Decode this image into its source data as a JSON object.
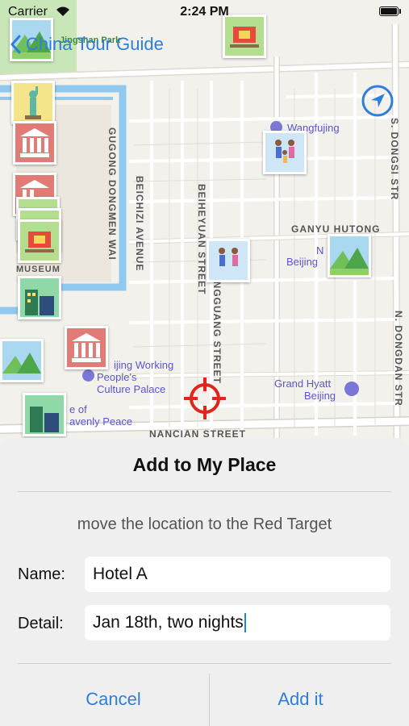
{
  "status_bar": {
    "carrier": "Carrier",
    "time": "2:24 PM"
  },
  "nav": {
    "back_label": "China Tour Guide"
  },
  "map": {
    "street_labels": {
      "gugong_dongmen": "GUGONG DONGMEN WAI",
      "beichizi": "BEICHIZI AVENUE",
      "beiheyuan": "BEIHEYUAN STREET",
      "hengguang": "HENGGUANG STREET",
      "ganyu": "GANYU HUTONG",
      "s_dongsi": "S. DONGSI STR",
      "n_dongdan": "N. DONGDAN STR",
      "bottom_street": "NANCIAN STREET",
      "museum": "MUSEUM",
      "park": "Jingshan Park"
    },
    "poi": {
      "wangfujing": "Wangfujing",
      "beijing_1": "Beijing",
      "beijing_n": "N",
      "working_people_1": "ijing Working",
      "working_people_2": "People's",
      "working_people_3": "Culture Palace",
      "heavenly_1": "e of",
      "heavenly_2": "avenly Peace",
      "grand_hyatt_1": "Grand Hyatt",
      "grand_hyatt_2": "Beijing"
    }
  },
  "sheet": {
    "title": "Add to My Place",
    "hint": "move the location to the Red Target",
    "name_label": "Name:",
    "name_value": "Hotel A",
    "detail_label": "Detail:",
    "detail_value": "Jan 18th, two nights",
    "cancel_label": "Cancel",
    "add_label": "Add it"
  },
  "colors": {
    "accent": "#2f7fd8",
    "target": "#e0261c",
    "water": "#8fc9ef",
    "park": "#c9e6b8"
  }
}
